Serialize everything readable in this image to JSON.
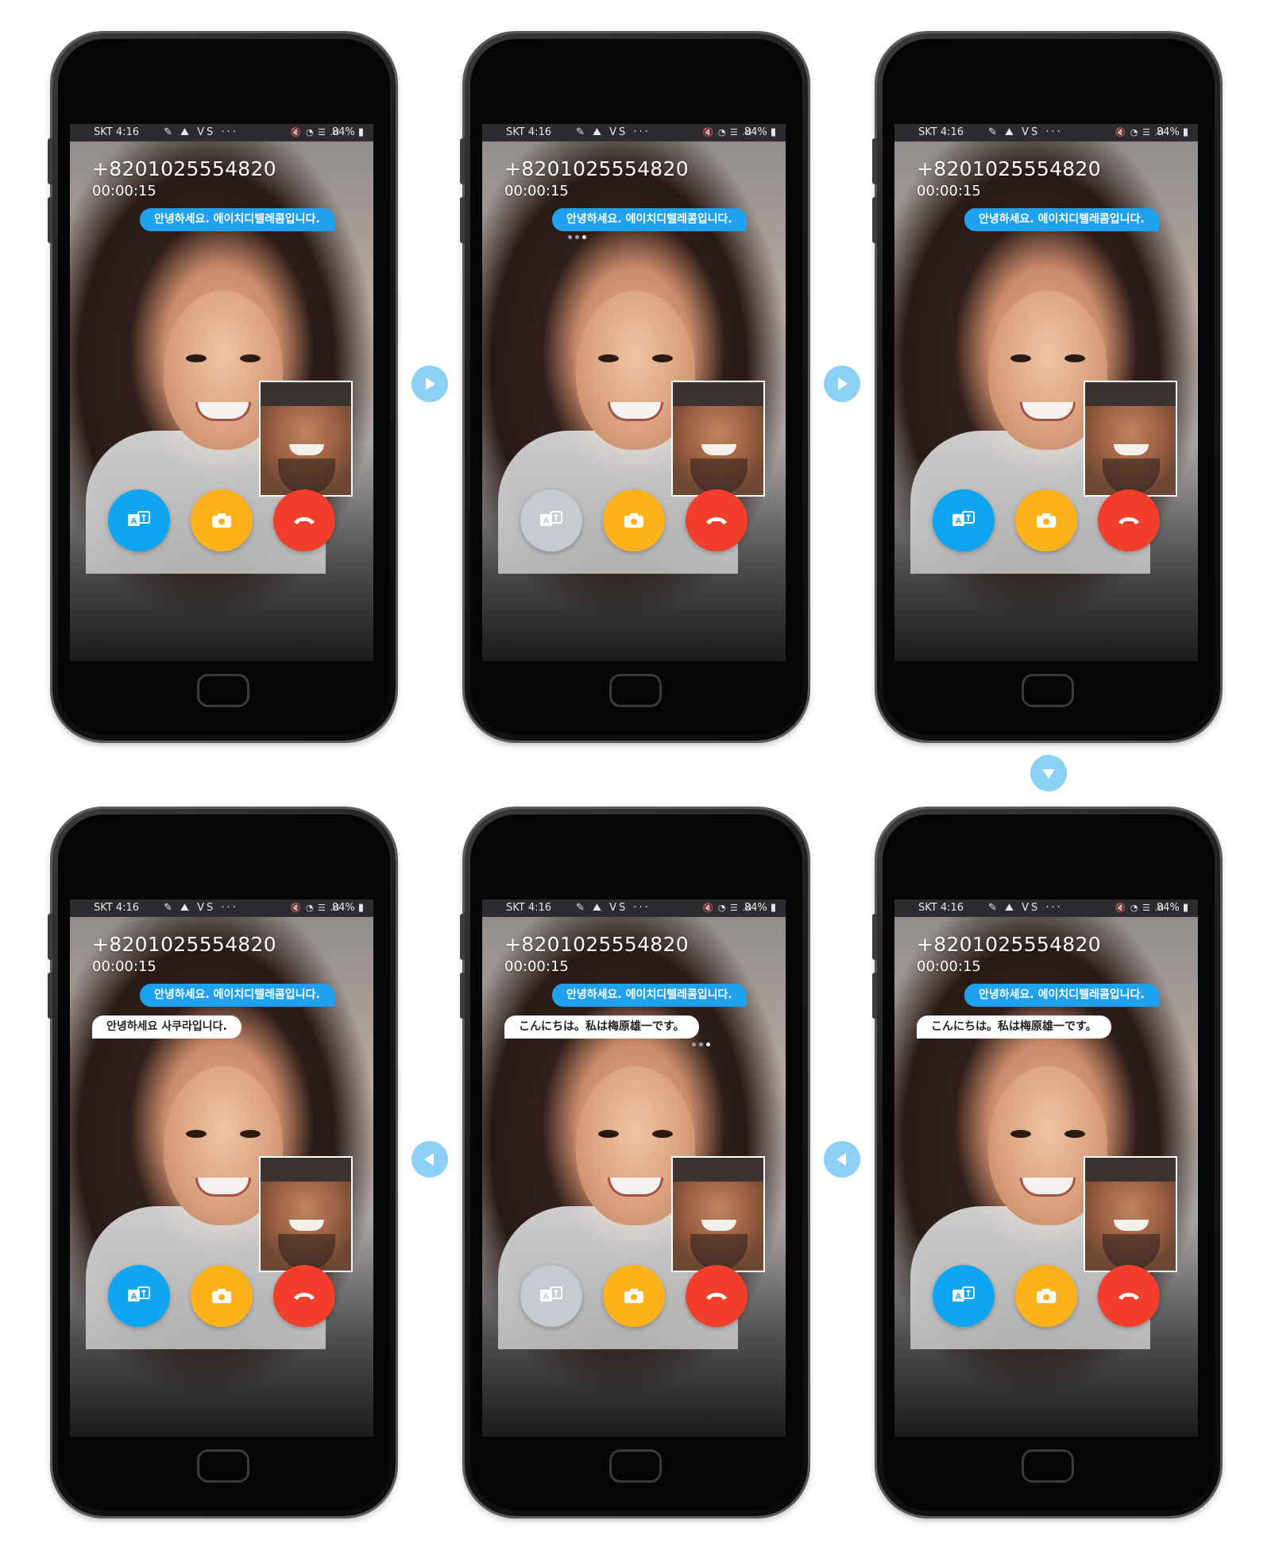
{
  "colors": {
    "translate_active": "#0ea5f2",
    "translate_inactive": "#c5cbd0",
    "camera": "#ffb21a",
    "hangup": "#f23f2b",
    "arrow": "#8dd0f6"
  },
  "status_bar": {
    "carrier_time": "SKT 4:16",
    "icons_left": "✎ ⛰ ⅤS ···",
    "icons_right": "🔇 ◔ ☰ .ıl",
    "battery": "84% ▮"
  },
  "call": {
    "number": "+8201025554820",
    "duration": "00:00:15"
  },
  "messages": {
    "greeting_ko": "안녕하세요. 에이치디텔레콤입니다.",
    "reply_ko": "안녕하세요 사쿠라입니다.",
    "reply_ja": "こんにちは。私は梅原雄一です。"
  },
  "icons": {
    "translate": "translate-icon",
    "camera": "camera-switch-icon",
    "hangup": "phone-hangup-icon",
    "arrow_right": "arrow-right-icon",
    "arrow_down": "arrow-down-icon",
    "arrow_left": "arrow-left-icon"
  }
}
